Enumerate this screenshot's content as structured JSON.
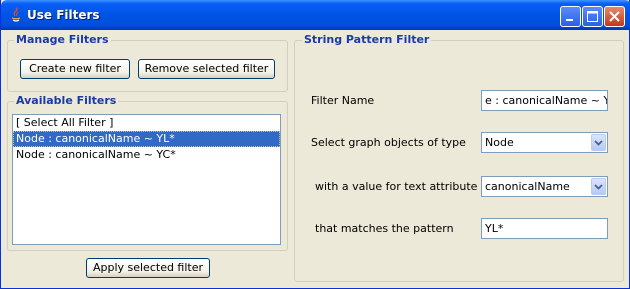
{
  "window": {
    "title": "Use Filters"
  },
  "manage": {
    "group_title": "Manage Filters",
    "create_label": "Create new filter",
    "remove_label": "Remove selected filter"
  },
  "available": {
    "group_title": "Available Filters",
    "items": [
      {
        "label": "[ Select All Filter ]",
        "selected": false
      },
      {
        "label": "Node : canonicalName ~ YL*",
        "selected": true
      },
      {
        "label": "Node : canonicalName ~ YC*",
        "selected": false
      }
    ],
    "apply_label": "Apply selected filter"
  },
  "pattern": {
    "group_title": "String Pattern Filter",
    "filter_name_label": "Filter Name",
    "filter_name_value": "e : canonicalName ~ YL*",
    "object_type_label": "Select graph objects of type",
    "object_type_value": "Node",
    "attribute_label": "with a value for text attribute",
    "attribute_value": "canonicalName",
    "pattern_label": "that matches the pattern",
    "pattern_value": "YL*"
  },
  "colors": {
    "titlebar": "#0054e3",
    "group_title": "#1a3aa8",
    "selection": "#316ac5",
    "background": "#ece9d8"
  }
}
